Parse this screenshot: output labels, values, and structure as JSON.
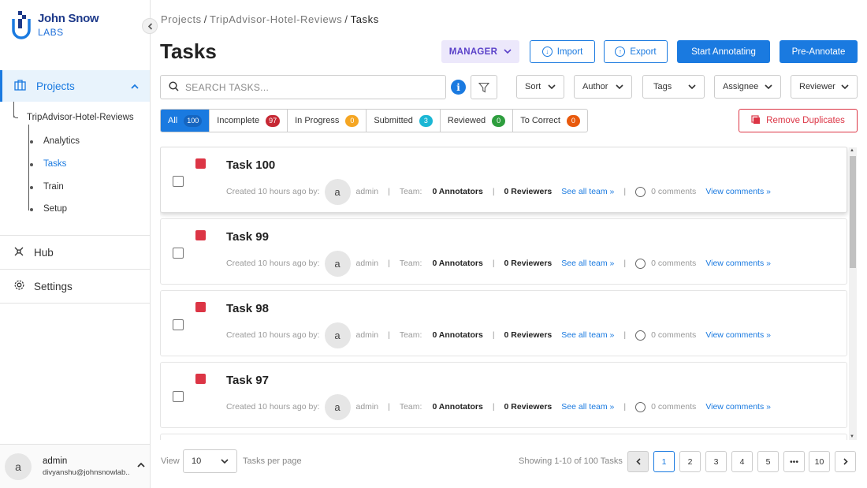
{
  "brand": {
    "line1": "John Snow",
    "line2": "LABS"
  },
  "sidebar": {
    "projects_label": "Projects",
    "project_name": "TripAdvisor-Hotel-Reviews",
    "subitems": [
      "Analytics",
      "Tasks",
      "Train",
      "Setup"
    ],
    "hub_label": "Hub",
    "settings_label": "Settings",
    "user": {
      "initial": "a",
      "name": "admin",
      "email": "divyanshu@johnsnowlab..."
    }
  },
  "breadcrumb": {
    "root": "Projects",
    "project": "TripAdvisor-Hotel-Reviews",
    "current": "Tasks",
    "sep": "/"
  },
  "page_title": "Tasks",
  "toolbar": {
    "manager": "MANAGER",
    "import": "Import",
    "export": "Export",
    "start": "Start Annotating",
    "pre": "Pre-Annotate"
  },
  "search": {
    "placeholder": "SEARCH TASKS..."
  },
  "filters": {
    "sort": "Sort",
    "author": "Author",
    "tags": "Tags",
    "assignee": "Assignee",
    "reviewer": "Reviewer"
  },
  "status_tabs": [
    {
      "label": "All",
      "count": "100",
      "color": "#1565c0"
    },
    {
      "label": "Incomplete",
      "count": "97",
      "color": "#c62834"
    },
    {
      "label": "In Progress",
      "count": "0",
      "color": "#f5a623"
    },
    {
      "label": "Submitted",
      "count": "3",
      "color": "#1ab6d4"
    },
    {
      "label": "Reviewed",
      "count": "0",
      "color": "#2e9e3e"
    },
    {
      "label": "To Correct",
      "count": "0",
      "color": "#e8590c"
    }
  ],
  "remove_duplicates": "Remove Duplicates",
  "task_common": {
    "created": "Created 10 hours ago by:",
    "author_initial": "a",
    "author": "admin",
    "team": "Team:",
    "annotators": "0 Annotators",
    "reviewers": "0 Reviewers",
    "see_team": "See all team »",
    "comments": "0 comments",
    "view_comments": "View comments »"
  },
  "tasks": [
    {
      "title": "Task 100"
    },
    {
      "title": "Task 99"
    },
    {
      "title": "Task 98"
    },
    {
      "title": "Task 97"
    }
  ],
  "footer": {
    "view": "View",
    "per_page_value": "10",
    "per_page_label": "Tasks per page",
    "showing": "Showing 1-10 of 100 Tasks",
    "pages": [
      "1",
      "2",
      "3",
      "4",
      "5",
      "•••",
      "10"
    ]
  },
  "colors": {
    "accent": "#1a7ae0",
    "danger": "#dc3545",
    "manager_bg": "#ece8fb",
    "manager_fg": "#5b42c9"
  }
}
